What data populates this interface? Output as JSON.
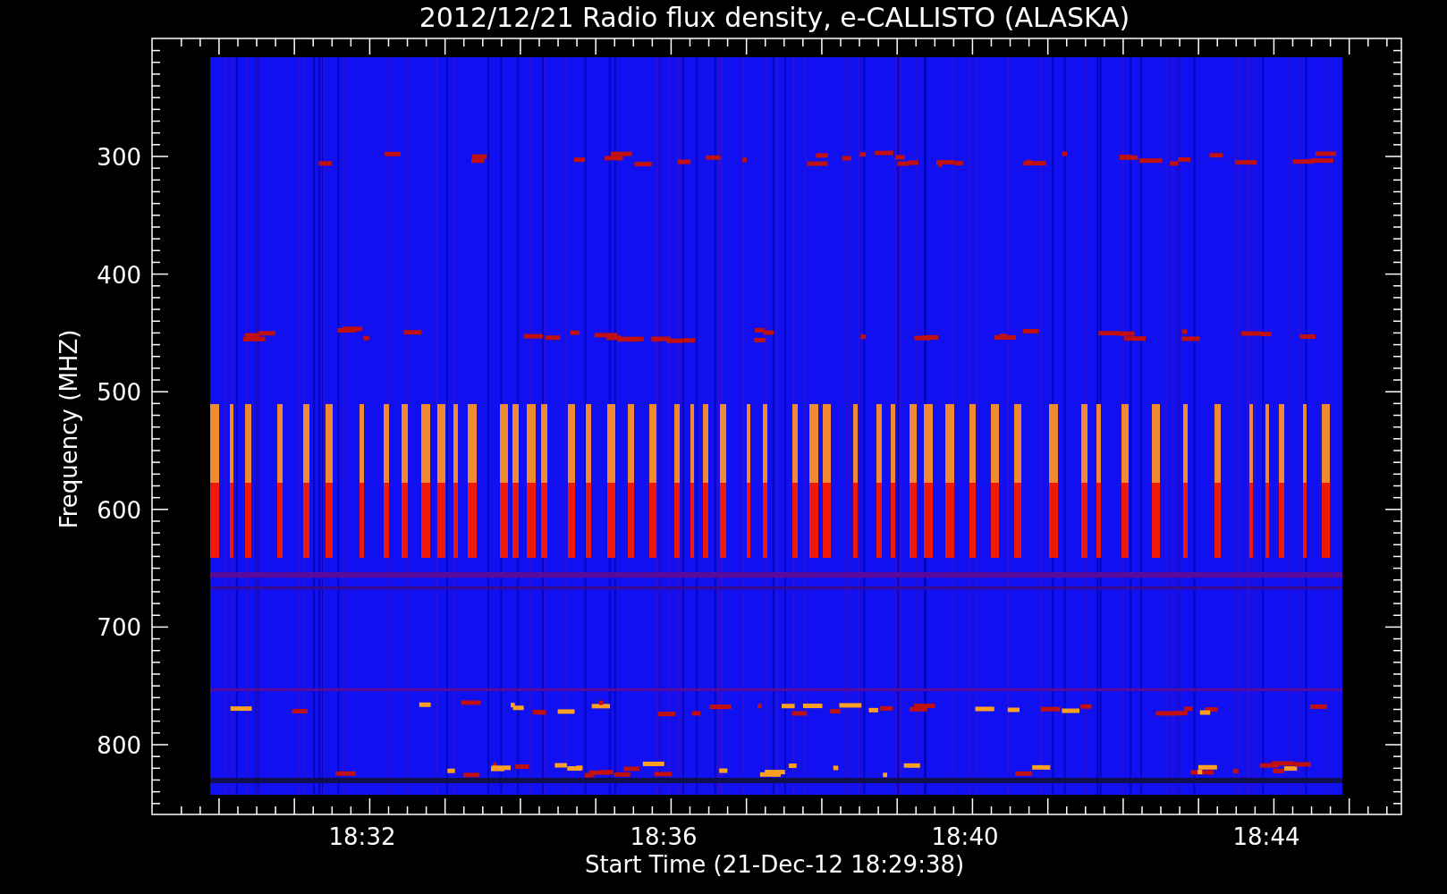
{
  "title": "2012/12/21  Radio flux density, e-CALLISTO (ALASKA)",
  "y_axis": {
    "label": "Frequency (MHZ)",
    "tick_labels": [
      "300",
      "400",
      "500",
      "600",
      "700",
      "800"
    ]
  },
  "x_axis": {
    "label": "Start Time (21-Dec-12 18:29:38)",
    "tick_labels": [
      "18:32",
      "18:36",
      "18:40",
      "18:44"
    ]
  }
}
